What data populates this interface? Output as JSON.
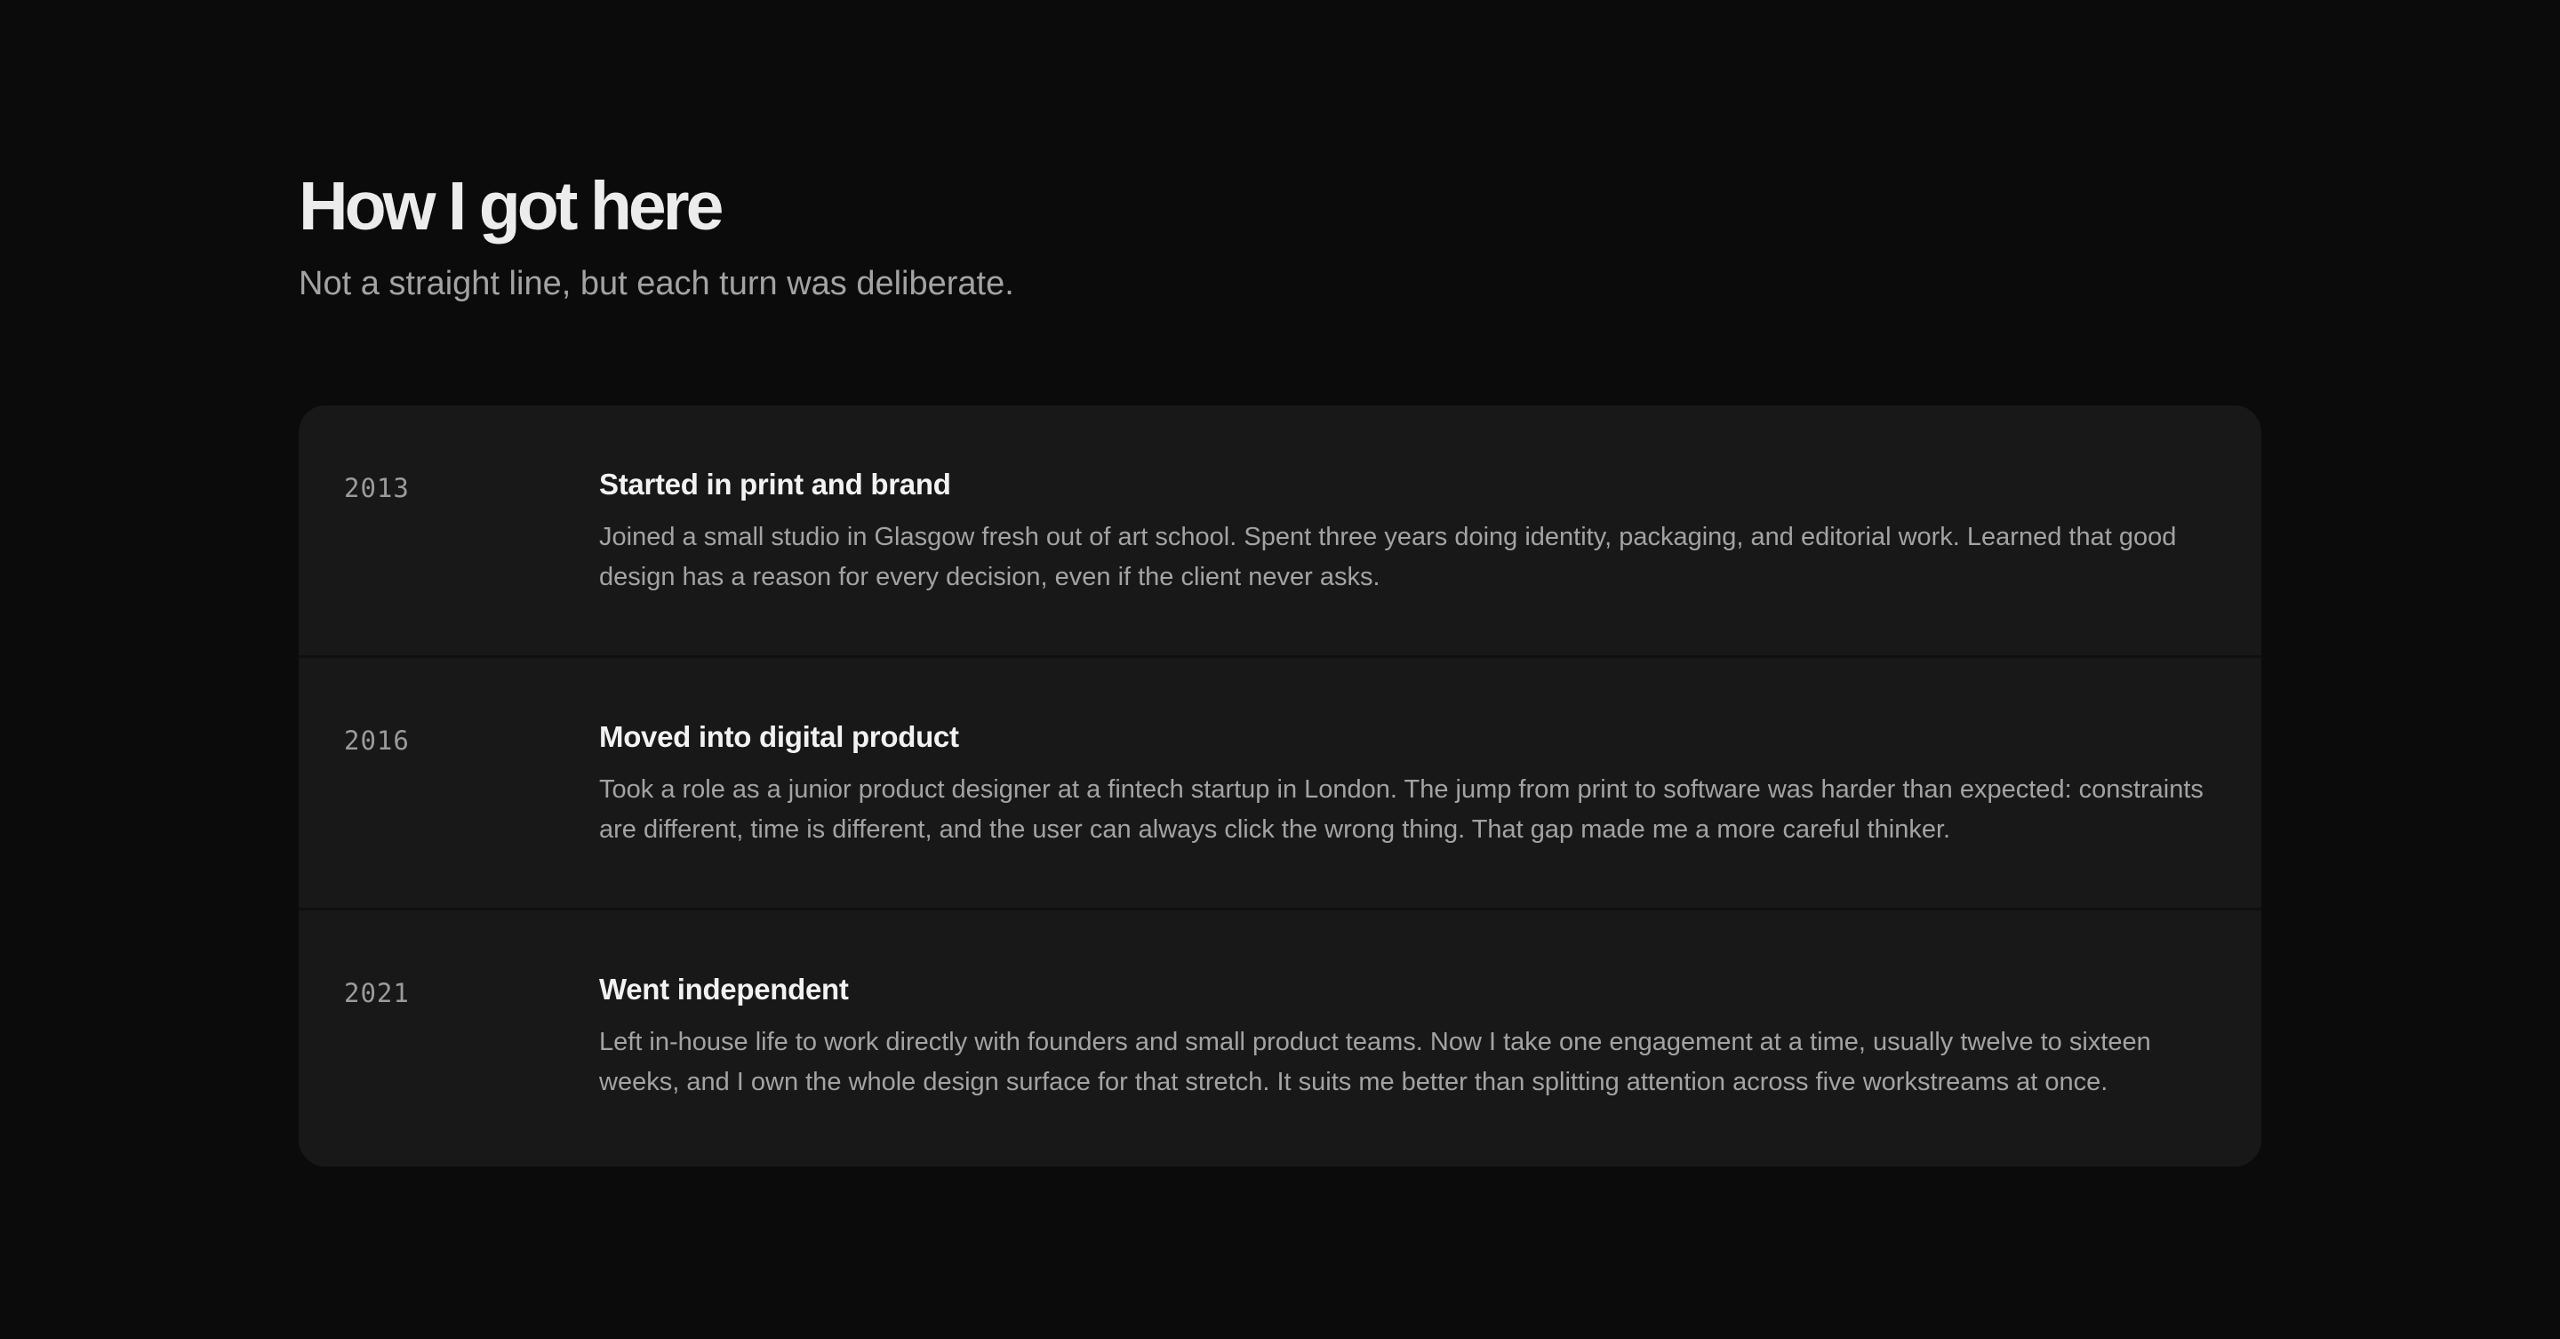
{
  "header": {
    "title": "How I got here",
    "subtitle": "Not a straight line, but each turn was deliberate."
  },
  "timeline": {
    "items": [
      {
        "year": "2013",
        "title": "Started in print and brand",
        "body": "Joined a small studio in Glasgow fresh out of art school. Spent three years doing identity, packaging, and editorial work. Learned that good design has a reason for every decision, even if the client never asks."
      },
      {
        "year": "2016",
        "title": "Moved into digital product",
        "body": "Took a role as a junior product designer at a fintech startup in London. The jump from print to software was harder than expected: constraints are different, time is different, and the user can always click the wrong thing. That gap made me a more careful thinker."
      },
      {
        "year": "2021",
        "title": "Went independent",
        "body": "Left in-house life to work directly with founders and small product teams. Now I take one engagement at a time, usually twelve to sixteen weeks, and I own the whole design surface for that stretch. It suits me better than splitting attention across five workstreams at once."
      }
    ]
  },
  "colors": {
    "background": "#0b0b0b",
    "card": "#181818",
    "heading": "#ececec",
    "muted": "#a3a3a3"
  }
}
